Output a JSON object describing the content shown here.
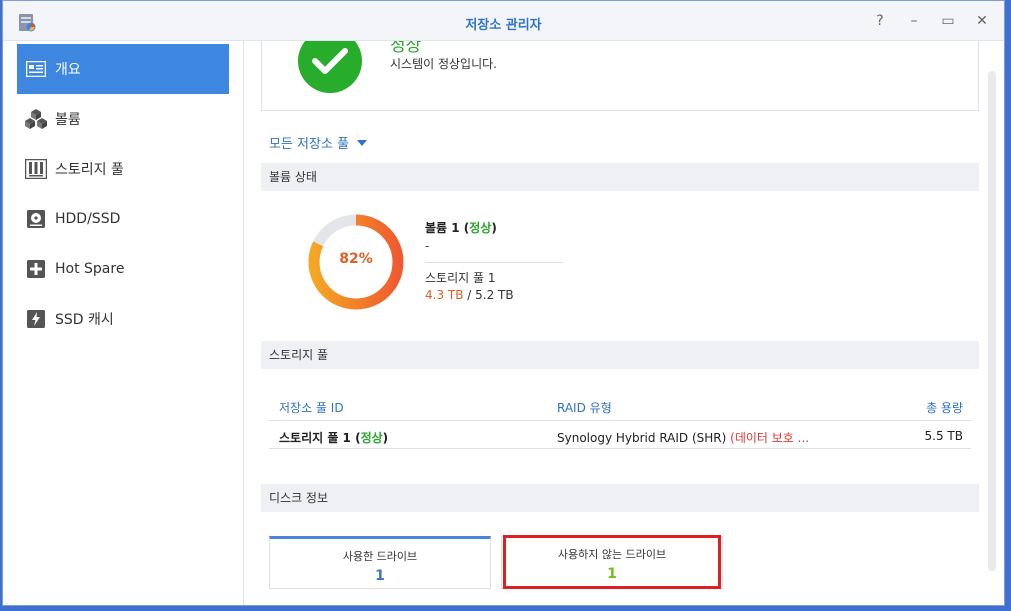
{
  "window": {
    "title": "저장소 관리자"
  },
  "sidebar": {
    "items": [
      {
        "label": "개요",
        "icon": "overview-icon",
        "active": true
      },
      {
        "label": "볼륨",
        "icon": "volume-icon",
        "active": false
      },
      {
        "label": "스토리지 풀",
        "icon": "storage-pool-icon",
        "active": false
      },
      {
        "label": "HDD/SSD",
        "icon": "disk-icon",
        "active": false
      },
      {
        "label": "Hot Spare",
        "icon": "hot-spare-icon",
        "active": false
      },
      {
        "label": "SSD 캐시",
        "icon": "ssd-cache-icon",
        "active": false
      }
    ]
  },
  "status": {
    "title": "정상",
    "description": "시스템이 정상입니다."
  },
  "pool_filter": {
    "label": "모든 저장소 풀"
  },
  "sections": {
    "volume_status": "볼륨 상태",
    "storage_pool": "스토리지 풀",
    "disk_info": "디스크 정보"
  },
  "volume": {
    "usage_percent": 82,
    "usage_label": "82%",
    "name": "볼륨 1",
    "status": "정상",
    "description": "-",
    "pool": "스토리지 풀 1",
    "used": "4.3 TB",
    "total": "5.2 TB"
  },
  "pool_table": {
    "headers": {
      "id": "저장소 풀 ID",
      "raid": "RAID 유형",
      "capacity": "총 용량"
    },
    "rows": [
      {
        "name": "스토리지 풀 1",
        "status": "정상",
        "raid": "Synology Hybrid RAID (SHR)",
        "raid_note": "(데이터 보호 ...",
        "capacity": "5.5 TB"
      }
    ]
  },
  "disks": {
    "used_label": "사용한 드라이브",
    "used_count": "1",
    "unused_label": "사용하지 않는 드라이브",
    "unused_count": "1"
  },
  "colors": {
    "accent": "#3d87e0",
    "ok": "#2aa62c",
    "usage": "#e35f24",
    "warning": "#d9383a",
    "highlight": "#e02020"
  }
}
